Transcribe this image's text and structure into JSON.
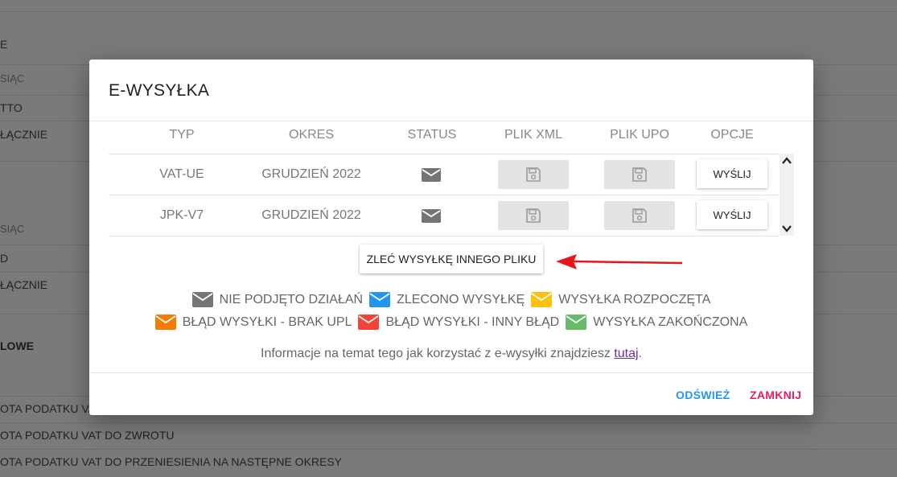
{
  "background": {
    "items": [
      "E",
      "SIĄC",
      "TTO",
      "ŁĄCZNIE",
      "SIĄC",
      "D",
      "ŁĄCZNIE",
      "LOWE",
      "OTA PODATKU VAT",
      "OTA PODATKU VAT DO ZWROTU",
      "OTA PODATKU VAT DO PRZENIESIENIA NA NASTĘPNE OKRESY"
    ]
  },
  "modal": {
    "title": "E-WYSYŁKA",
    "columns": [
      "TYP",
      "OKRES",
      "STATUS",
      "PLIK XML",
      "PLIK UPO",
      "OPCJE"
    ],
    "rows": [
      {
        "type": "VAT-UE",
        "period": "GRUDZIEŃ 2022",
        "status_icon": "envelope-icon",
        "send_label": "WYŚLIJ"
      },
      {
        "type": "JPK-V7",
        "period": "GRUDZIEŃ 2022",
        "status_icon": "envelope-icon",
        "send_label": "WYŚLIJ"
      }
    ],
    "order_button": "ZLEĆ WYSYŁKĘ INNEGO PLIKU",
    "legend": [
      {
        "label": "NIE PODJĘTO DZIAŁAŃ",
        "color": "#757575"
      },
      {
        "label": "ZLECONO WYSYŁKĘ",
        "color": "#2196f3"
      },
      {
        "label": "WYSYŁKA ROZPOCZĘTA",
        "color": "#ffc107"
      },
      {
        "label": "BŁĄD WYSYŁKI - BRAK UPL",
        "color": "#f57c00"
      },
      {
        "label": "BŁĄD WYSYŁKI - INNY BŁĄD",
        "color": "#f44336"
      },
      {
        "label": "WYSYŁKA ZAKOŃCZONA",
        "color": "#66bb6a"
      }
    ],
    "info_text": "Informacje na temat tego jak korzystać z e-wysyłki znajdziesz ",
    "info_link": "tutaj",
    "info_end": ".",
    "refresh_label": "ODŚWIEŻ",
    "close_label": "ZAMKNIJ",
    "colors": {
      "refresh": "#2196f3",
      "close": "#e91e63",
      "arrow": "#e8151b"
    }
  }
}
